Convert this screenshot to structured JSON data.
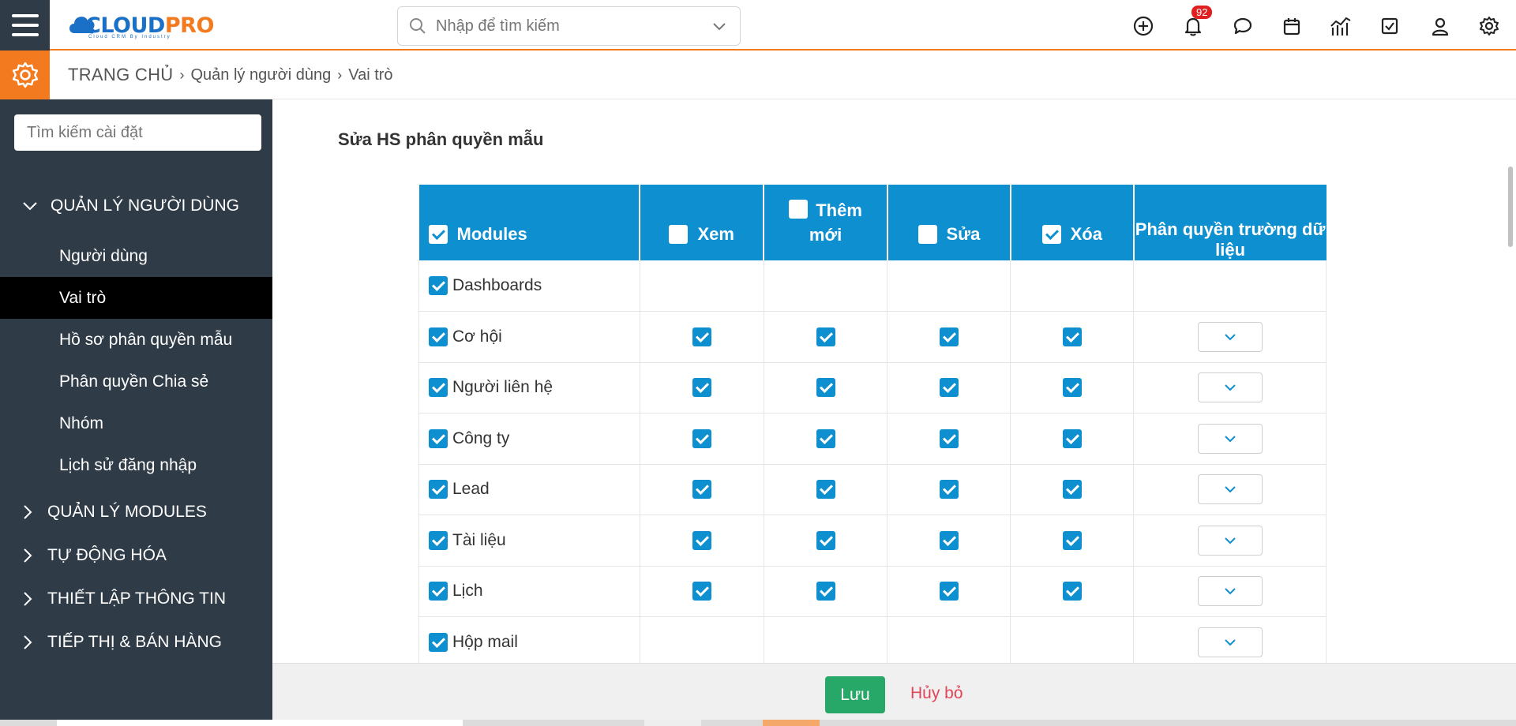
{
  "header": {
    "logo_main": "CLOUD",
    "logo_accent": "PRO",
    "logo_tagline": "Cloud CRM By Industry",
    "search_placeholder": "Nhập để tìm kiếm",
    "notification_count": "92",
    "icons": [
      "plus-circle-icon",
      "bell-icon",
      "chat-icon",
      "calendar-icon",
      "chart-icon",
      "checkbox-icon",
      "user-icon",
      "gear-icon"
    ]
  },
  "breadcrumb": {
    "home": "TRANG CHỦ",
    "level1": "Quản lý người dùng",
    "level2": "Vai trò"
  },
  "sidebar": {
    "search_placeholder": "Tìm kiếm cài đặt",
    "group_user": "QUẢN LÝ NGƯỜI DÙNG",
    "items": [
      "Người dùng",
      "Vai trò",
      "Hồ sơ phân quyền mẫu",
      "Phân quyền Chia sẻ",
      "Nhóm",
      "Lịch sử đăng nhập"
    ],
    "active_item": "Vai trò",
    "groups": [
      "QUẢN LÝ MODULES",
      "TỰ ĐỘNG HÓA",
      "THIẾT LẬP THÔNG TIN",
      "TIẾP THỊ & BÁN HÀNG"
    ]
  },
  "main": {
    "title": "Sửa HS phân quyền mẫu",
    "columns": {
      "modules": "Modules",
      "view": "Xem",
      "add_line1": "Thêm",
      "add_line2": "mới",
      "edit": "Sửa",
      "delete": "Xóa",
      "field_perm": "Phân quyền trường dữ liệu"
    },
    "header_checks": {
      "modules": true,
      "view": false,
      "add": false,
      "edit": false,
      "delete": true
    },
    "rows": [
      {
        "name": "Dashboards",
        "perms": false,
        "dropdown": false
      },
      {
        "name": "Cơ hội",
        "perms": true,
        "dropdown": true
      },
      {
        "name": "Người liên hệ",
        "perms": true,
        "dropdown": true
      },
      {
        "name": "Công ty",
        "perms": true,
        "dropdown": true
      },
      {
        "name": "Lead",
        "perms": true,
        "dropdown": true
      },
      {
        "name": "Tài liệu",
        "perms": true,
        "dropdown": true
      },
      {
        "name": "Lịch",
        "perms": true,
        "dropdown": true
      },
      {
        "name": "Hộp mail",
        "perms": false,
        "dropdown": true
      }
    ]
  },
  "footer": {
    "save_label": "Lưu",
    "cancel_label": "Hủy bỏ"
  },
  "colors": {
    "accent_orange": "#f47a20",
    "sidebar_bg": "#2f3b47",
    "table_header_blue": "#0e8fd0",
    "save_green": "#28a868",
    "cancel_red": "#e0455a"
  }
}
